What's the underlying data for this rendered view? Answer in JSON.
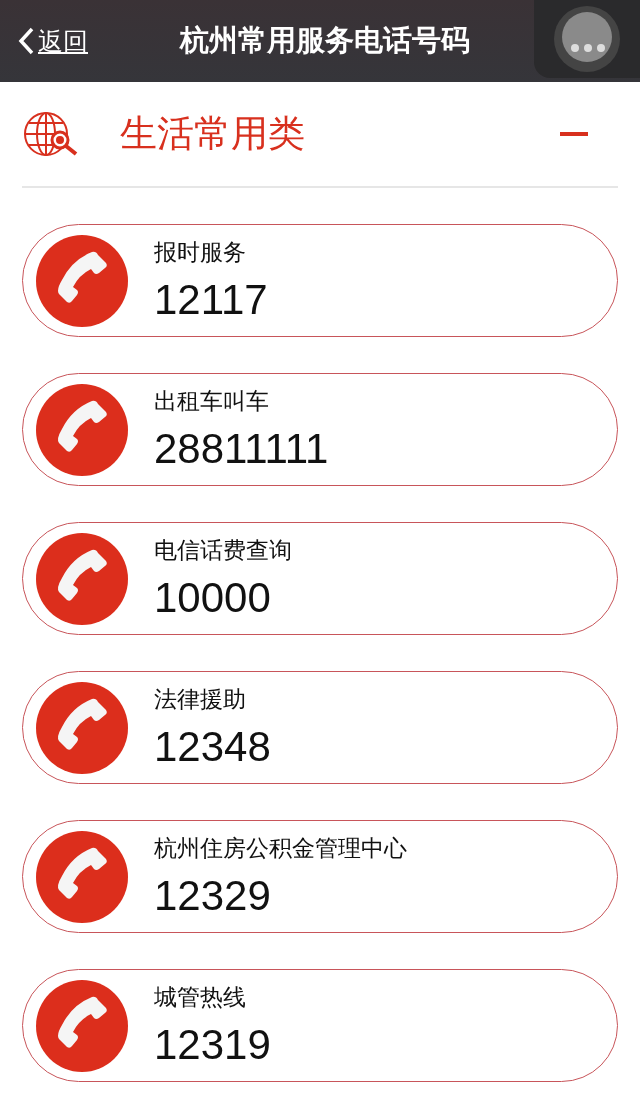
{
  "nav_bar": {
    "back": "返回",
    "title": "杭州常用服务电话号码"
  },
  "section": {
    "title": "生活常用类",
    "expanded": true
  },
  "contacts": [
    {
      "name": "报时服务",
      "number": "12117"
    },
    {
      "name": "出租车叫车",
      "number": "28811111"
    },
    {
      "name": "电信话费查询",
      "number": "10000"
    },
    {
      "name": "法律援助",
      "number": "12348"
    },
    {
      "name": "杭州住房公积金管理中心",
      "number": "12329"
    },
    {
      "name": "城管热线",
      "number": "12319"
    }
  ]
}
